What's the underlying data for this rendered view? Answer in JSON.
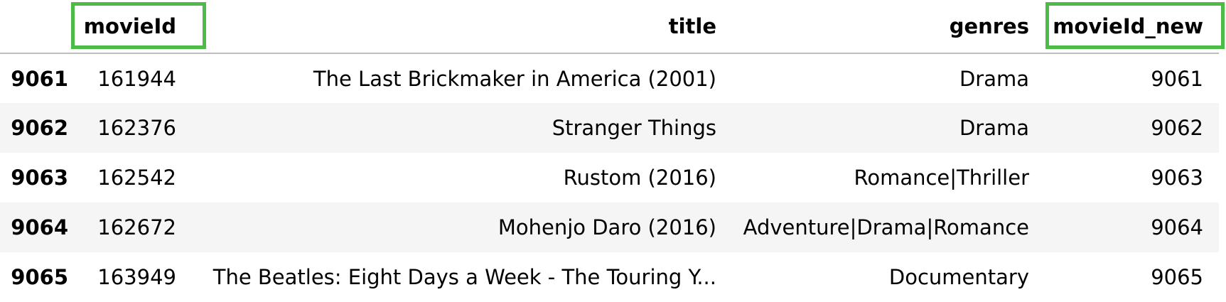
{
  "table": {
    "columns": [
      "movieId",
      "title",
      "genres",
      "movieId_new"
    ],
    "rows": [
      {
        "index": "9061",
        "movieId": "161944",
        "title": "The Last Brickmaker in America (2001)",
        "genres": "Drama",
        "movieId_new": "9061"
      },
      {
        "index": "9062",
        "movieId": "162376",
        "title": "Stranger Things",
        "genres": "Drama",
        "movieId_new": "9062"
      },
      {
        "index": "9063",
        "movieId": "162542",
        "title": "Rustom (2016)",
        "genres": "Romance|Thriller",
        "movieId_new": "9063"
      },
      {
        "index": "9064",
        "movieId": "162672",
        "title": "Mohenjo Daro (2016)",
        "genres": "Adventure|Drama|Romance",
        "movieId_new": "9064"
      },
      {
        "index": "9065",
        "movieId": "163949",
        "title": "The Beatles: Eight Days a Week - The Touring Y...",
        "genres": "Documentary",
        "movieId_new": "9065"
      }
    ]
  },
  "highlight_color": "#4cbb47"
}
